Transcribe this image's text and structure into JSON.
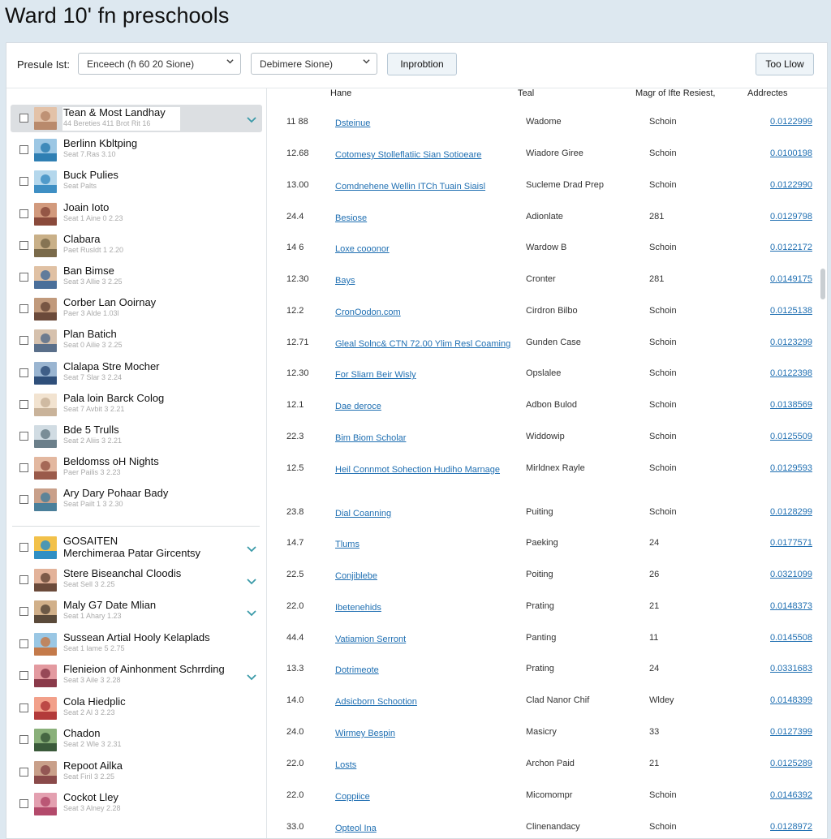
{
  "header": {
    "title": "Ward 10' fn preschools"
  },
  "toolbar": {
    "label": "Presule Ist:",
    "select1_value": "Enceech (ɦ 60 20 Sione)",
    "select2_value": "Debimere Sione)",
    "inprobtion_label": "Inprobtion",
    "too_low_label": "Too Llow"
  },
  "left_list": {
    "items": [
      {
        "name": "Tean & Most Landhay",
        "sub": "44 Bereties 411 Brot Rit 16",
        "selected": true,
        "checked": true
      },
      {
        "name": "Berlinn Kbltping",
        "sub": "Seat 7.Ras 3.10",
        "selected": false,
        "checked": false
      },
      {
        "name": "Buck Pulies",
        "sub": "Seat Palts",
        "selected": false,
        "checked": false
      },
      {
        "name": "Joain Ioto",
        "sub": "Seat 1 Aine 0 2.23",
        "selected": false,
        "checked": false
      },
      {
        "name": "Clabara",
        "sub": "Paet Rusldt 1 2.20",
        "selected": false,
        "checked": false
      },
      {
        "name": "Ban Bimse",
        "sub": "Seat 3 Allie 3 2.25",
        "selected": false,
        "checked": false
      },
      {
        "name": "Corber Lan Ooirnay",
        "sub": "Paer 3 Alde 1.03l",
        "selected": false,
        "checked": false
      },
      {
        "name": "Plan Batich",
        "sub": "Seat 0 Ailie 3 2.25",
        "selected": false,
        "checked": false
      },
      {
        "name": "Clalapa Stre Mocher",
        "sub": "Seat 7 Slar 3 2.24",
        "selected": false,
        "checked": false
      },
      {
        "name": "Pala loin Barck Colog",
        "sub": "Seat 7 Avbit 3 2.21",
        "selected": false,
        "checked": false
      },
      {
        "name": "Bde 5 Trulls",
        "sub": "Seat 2 Aliis 3 2.21",
        "selected": false,
        "checked": false
      },
      {
        "name": "Beldomss oH Nights",
        "sub": "Paer Pailis 3 2.23",
        "selected": false,
        "checked": false
      },
      {
        "name": "Ary Dary Pohaar Bady",
        "sub": "Seat Pailt 1 3 2.30",
        "selected": false,
        "checked": false
      }
    ],
    "group2": [
      {
        "name": "GOSAITEN",
        "name2": "Merchimeraa Patar Gircentsy",
        "sub": "",
        "checked": true
      },
      {
        "name": "Stere Biseanchal Cloodis",
        "sub": "Seat Sell 3 2.25",
        "checked": true
      },
      {
        "name": "Maly G7 Date Mlian",
        "sub": "Seat 1 Ahary 1.23",
        "checked": true
      },
      {
        "name": "Sussean Artial Hooly Kelaplads",
        "sub": "Seat 1 lame 5 2.75",
        "checked": false
      },
      {
        "name": "Flenieion of Ainhonment Schrrding",
        "sub": "Seat 3 Aile 3 2.28",
        "checked": true
      },
      {
        "name": "Cola Hiedplic",
        "sub": "Seat 2 Al 3 2.23",
        "checked": false
      },
      {
        "name": "Chadon",
        "sub": "Seat 2 Wle 3 2.31",
        "checked": false
      },
      {
        "name": "Repoot Ailka",
        "sub": "Seat Firil 3 2.25",
        "checked": false
      },
      {
        "name": "Cockot Lley",
        "sub": "Seat 3 Alney 2.28",
        "checked": false
      }
    ]
  },
  "table": {
    "columns": [
      "Hane",
      "Teal",
      "Magr of Ifte Resiest,",
      "Addrectes"
    ],
    "rows": [
      {
        "num": "11 88",
        "name": "Dsteinue",
        "teal": "Wadome",
        "mag": "Schoin",
        "addr": "0.0122999"
      },
      {
        "num": "12.68",
        "name": "Cotomesy Stolleflatiic Sian Sotioeare",
        "teal": "Wiadore Giree",
        "mag": "Schoin",
        "addr": "0.0100198"
      },
      {
        "num": "13.00",
        "name": "Comdnehene Wellin ITCh Tuain Siaisl",
        "teal": "Sucleme Drad Prep",
        "mag": "Schoin",
        "addr": "0.0122990"
      },
      {
        "num": "24.4",
        "name": "Besiose",
        "teal": "Adionlate",
        "mag": "281",
        "addr": "0.0129798"
      },
      {
        "num": "14 6",
        "name": "Loxe cooonor",
        "teal": "Wardow B",
        "mag": "Schoin",
        "addr": "0.0122172"
      },
      {
        "num": "12.30",
        "name": "Bays",
        "teal": "Cronter",
        "mag": "281",
        "addr": "0.0149175"
      },
      {
        "num": "12.2",
        "name": "CronOodon.com",
        "teal": "Cirdron Bilbo",
        "mag": "Schoin",
        "addr": "0.0125138"
      },
      {
        "num": "12.71",
        "name": "Gleal Solnc& CTN 72.00 Ylim Resl Coaming",
        "teal": "Gunden Case",
        "mag": "Schoin",
        "addr": "0.0123299"
      },
      {
        "num": "12.30",
        "name": "For Sliarn Beir Wisly",
        "teal": "Opslalee",
        "mag": "Schoin",
        "addr": "0.0122398"
      },
      {
        "num": "12.1",
        "name": "Dae deroce",
        "teal": "Adbon Bulod",
        "mag": "Schoin",
        "addr": "0.0138569"
      },
      {
        "num": "22.3",
        "name": "Bim Biom Scholar",
        "teal": "Widdowip",
        "mag": "Schoin",
        "addr": "0.0125509"
      },
      {
        "num": "12.5",
        "name": "Heil Connmot Sohection Hudiho Marnage",
        "teal": "Mirldnex Rayle",
        "mag": "Schoin",
        "addr": "0.0129593"
      },
      {
        "num": "23.8",
        "name": "Dial Coanning",
        "teal": "Puiting",
        "mag": "Schoin",
        "addr": "0.0128299"
      },
      {
        "num": "14.7",
        "name": "Tlums",
        "teal": "Paeking",
        "mag": "24",
        "addr": "0.0177571"
      },
      {
        "num": "22.5",
        "name": "Conjiblebe",
        "teal": "Poiting",
        "mag": "26",
        "addr": "0.0321099"
      },
      {
        "num": "22.0",
        "name": "Ibetenehids",
        "teal": "Prating",
        "mag": "21",
        "addr": "0.0148373"
      },
      {
        "num": "44.4",
        "name": "Vatiamion Serront",
        "teal": "Panting",
        "mag": "11",
        "addr": "0.0145508"
      },
      {
        "num": "13.3",
        "name": "Dotrimeote",
        "teal": "Prating",
        "mag": "24",
        "addr": "0.0331683"
      },
      {
        "num": "14.0",
        "name": "Adsicborn Schootion",
        "teal": "Clad Nanor Chif",
        "mag": "Wldey",
        "addr": "0.0148399"
      },
      {
        "num": "24.0",
        "name": "Wirmey Bespin",
        "teal": "Masicry",
        "mag": "33",
        "addr": "0.0127399"
      },
      {
        "num": "22.0",
        "name": "Losts",
        "teal": "Archon Paid",
        "mag": "21",
        "addr": "0.0125289"
      },
      {
        "num": "22.0",
        "name": "Coppiice",
        "teal": "Micomompr",
        "mag": "Schoin",
        "addr": "0.0146392"
      },
      {
        "num": "33.0",
        "name": "Opteol Ina",
        "teal": "Clinenandacy",
        "mag": "Schoin",
        "addr": "0.0128972"
      }
    ]
  },
  "colors": {
    "link": "#1f6fb2",
    "check": "#3a9aa8",
    "selected_row": "#dcdfe2"
  }
}
